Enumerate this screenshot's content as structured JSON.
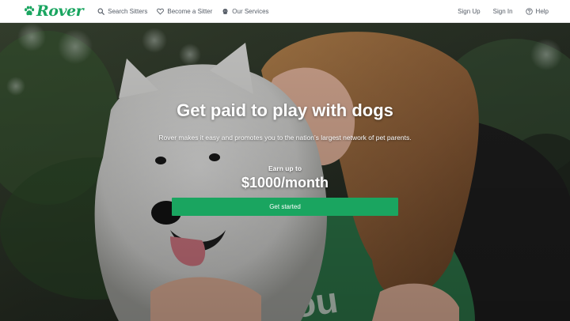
{
  "brand": {
    "name": "Rover",
    "color": "#1aa560",
    "logo_icon": "paw-icon"
  },
  "nav": {
    "left": [
      {
        "label": "Search Sitters",
        "icon": "search-icon"
      },
      {
        "label": "Become a Sitter",
        "icon": "heart-icon"
      },
      {
        "label": "Our Services",
        "icon": "dog-icon"
      }
    ],
    "right": [
      {
        "label": "Sign Up"
      },
      {
        "label": "Sign In"
      },
      {
        "label": "Help",
        "icon": "help-icon"
      }
    ]
  },
  "hero": {
    "headline": "Get paid to play with dogs",
    "subtitle": "Rover makes it easy and promotes you to the nation’s largest network of pet parents.",
    "earn_label": "Earn up to",
    "earn_amount": "$1000/month",
    "cta_label": "Get started",
    "cta_color": "#1aa560"
  }
}
